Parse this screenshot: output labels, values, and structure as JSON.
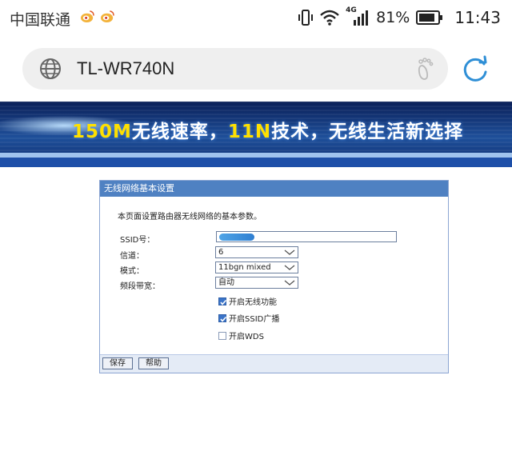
{
  "status_bar": {
    "carrier": "中国联通",
    "network": "4G",
    "battery": "81%",
    "time": "11:43"
  },
  "browser": {
    "url": "TL-WR740N"
  },
  "banner": {
    "part1": "150M",
    "part2": "无线速率，",
    "part3": "11N",
    "part4": "技术，无线生活新选择"
  },
  "panel": {
    "title": "无线网络基本设置",
    "description": "本页面设置路由器无线网络的基本参数。",
    "fields": {
      "ssid_label": "SSID号：",
      "channel_label": "信道：",
      "channel_value": "6",
      "mode_label": "模式：",
      "mode_value": "11bgn mixed",
      "bandwidth_label": "频段带宽：",
      "bandwidth_value": "自动"
    },
    "checkboxes": {
      "wireless_label": "开启无线功能",
      "ssid_broadcast_label": "开启SSID广播",
      "wds_label": "开启WDS"
    },
    "buttons": {
      "save": "保存",
      "help": "帮助"
    }
  },
  "colors": {
    "panel_header": "#4f81c2",
    "banner_highlight": "#ffe000",
    "refresh_icon": "#2f8fd6"
  }
}
